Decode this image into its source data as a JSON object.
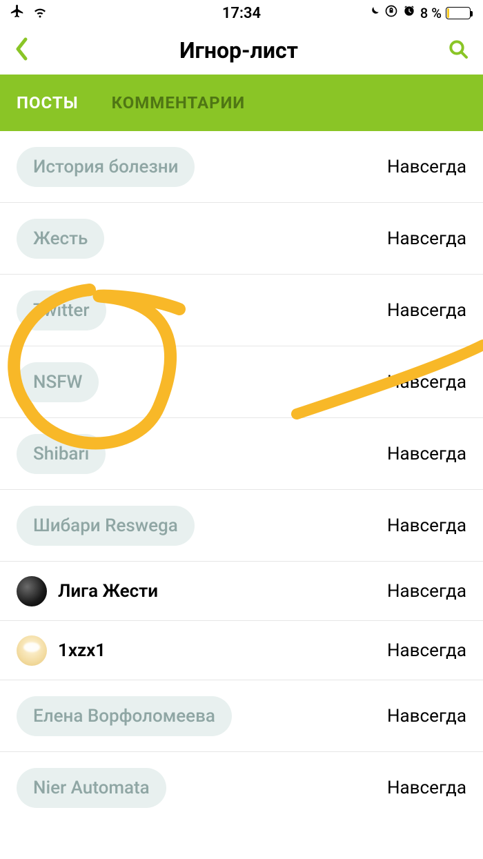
{
  "status": {
    "time": "17:34",
    "battery_pct": "8 %"
  },
  "header": {
    "title": "Игнор-лист"
  },
  "tabs": {
    "posts": "ПОСТЫ",
    "comments": "КОММЕНТАРИИ"
  },
  "duration_label": "Навсегда",
  "items": [
    {
      "type": "chip",
      "label": "История болезни"
    },
    {
      "type": "chip",
      "label": "Жесть"
    },
    {
      "type": "chip",
      "label": "Twitter"
    },
    {
      "type": "chip",
      "label": "NSFW"
    },
    {
      "type": "chip",
      "label": "Shibari"
    },
    {
      "type": "chip",
      "label": "Шибари Reswega"
    },
    {
      "type": "user",
      "avatar": "dark",
      "label": "Лига Жести"
    },
    {
      "type": "user",
      "avatar": "cream",
      "label": "1xzx1"
    },
    {
      "type": "chip",
      "label": "Елена Ворфоломеева"
    },
    {
      "type": "chip",
      "label": "Nier Automata"
    }
  ],
  "annotation": {
    "description": "Hand-drawn yellow circle around the NSFW row with an arrow/stroke pointing from the right side",
    "color": "#f8b828"
  }
}
